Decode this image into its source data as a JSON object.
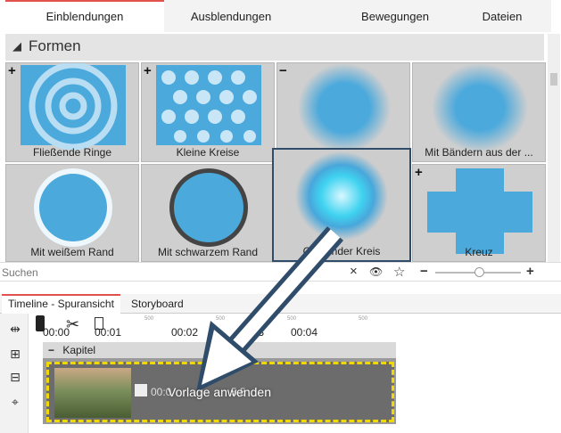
{
  "tabs": [
    {
      "label": "Einblendungen",
      "active": true
    },
    {
      "label": "Ausblendungen",
      "active": false
    },
    {
      "label": "Bewegungen",
      "active": false
    },
    {
      "label": "Dateien",
      "active": false
    }
  ],
  "group": {
    "title": "Formen",
    "toggle": "◢"
  },
  "tiles": [
    {
      "caption": "Fließende Ringe",
      "badge": "+"
    },
    {
      "caption": "Kleine Kreise",
      "badge": "+"
    },
    {
      "caption": "",
      "badge": "−"
    },
    {
      "caption": "Mit Bändern aus der ...",
      "badge": ""
    },
    {
      "caption": "Mit weißem Rand",
      "badge": ""
    },
    {
      "caption": "Mit schwarzem Rand",
      "badge": ""
    },
    {
      "caption": "Glühender Kreis",
      "badge": "",
      "selected": true
    },
    {
      "caption": "Kreuz",
      "badge": "+"
    }
  ],
  "search": {
    "placeholder": "Suchen",
    "clear": "×",
    "eye": "👁",
    "star": "☆",
    "minus": "−",
    "plus": "+"
  },
  "timeline_tabs": [
    {
      "label": "Timeline - Spuransicht",
      "active": true
    },
    {
      "label": "Storyboard",
      "active": false
    }
  ],
  "ruler": {
    "labels": [
      "00:00",
      "00:01",
      "00:02",
      "00:03",
      "00:04"
    ],
    "sub": "500"
  },
  "chapter": {
    "label": "Kapitel",
    "toggle": "−"
  },
  "clip": {
    "duration": "00:0",
    "tail": "5,5"
  },
  "overlay": {
    "label": "Vorlage anwenden"
  },
  "colors": {
    "accent": "#e0524b",
    "selected_border": "#2f4c6a",
    "clip_border": "#f0d800",
    "arrow": "#2f4c6a"
  }
}
